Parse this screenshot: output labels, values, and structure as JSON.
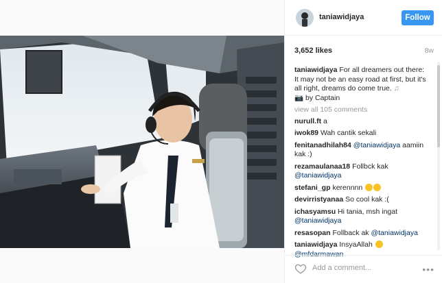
{
  "post": {
    "username": "taniawidjaya",
    "follow_label": "Follow",
    "likes": "3,652 likes",
    "age": "8w",
    "caption_user": "taniawidjaya",
    "caption_text": "For all dreamers out there: It may not be an easy road at first, but it's all right, dreams do come true. ",
    "caption_tail": " by Captain",
    "view_all": "view all 105 comments",
    "add_comment_placeholder": "Add a comment...",
    "more_icon": "•••"
  },
  "comments": [
    {
      "user": "nurull.ft",
      "text": "a"
    },
    {
      "user": "iwok89",
      "text": "Wah cantik sekali"
    },
    {
      "user": "fenitanadhilah84",
      "mention": "@taniawidjaya",
      "text": " aamiin kak :)"
    },
    {
      "user": "rezamaulanaa18",
      "text": "Follbck kak",
      "mention_after": "@taniawidjaya"
    },
    {
      "user": "stefani_gp",
      "text": "kerennnn"
    },
    {
      "user": "devirristyanaa",
      "text": "So cool kak :("
    },
    {
      "user": "ichasyamsu",
      "text": "Hi tania, msh ingat",
      "mention_after": "@taniawidjaya"
    },
    {
      "user": "resasopan",
      "text": "Follback ak",
      "mention": "@taniawidjaya"
    },
    {
      "user": "taniawidjaya",
      "text": "InsyaAllah",
      "mention_after": "@mfdarmawan"
    }
  ],
  "icons": {
    "heart": "heart-icon",
    "more": "more-icon",
    "music": "music-note-icon",
    "camera": "camera-icon"
  },
  "colors": {
    "follow": "#3897f0",
    "mention": "#003569",
    "muted": "#999999"
  }
}
